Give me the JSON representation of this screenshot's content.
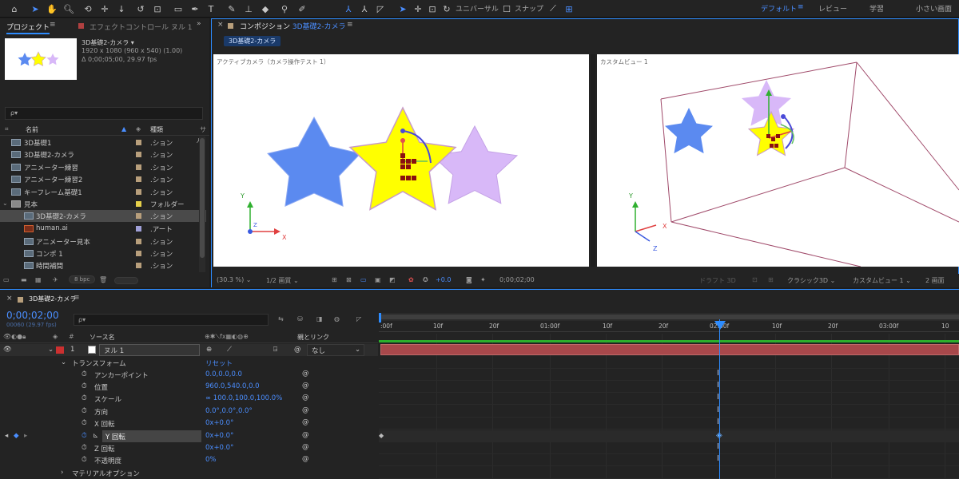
{
  "toolbar": {
    "home": "⌂",
    "snapping_label": "スナップ",
    "universal_label": "ユニバーサル"
  },
  "workspaces": {
    "default": "デフォルト",
    "review": "レビュー",
    "learn": "学習",
    "small": "小さい画面"
  },
  "project": {
    "tab_label": "プロジェクト",
    "effect_tab_label": "エフェクトコントロール ヌル 1",
    "comp_name": "3D基礎2-カメラ ▾",
    "comp_size": "1920 x 1080  (960 x 540) (1.00)",
    "comp_duration": "Δ 0;00;05;00, 29.97 fps",
    "search_placeholder": "ρ▾",
    "col_name": "名前",
    "col_type": "種類",
    "items": [
      {
        "name": "3D基礎1",
        "type": ".ション"
      },
      {
        "name": "3D基礎2-カメラ",
        "type": ".ション"
      },
      {
        "name": "アニメーター練習",
        "type": ".ション"
      },
      {
        "name": "アニメーター練習2",
        "type": ".ション"
      },
      {
        "name": "キーフレーム基礎1",
        "type": ".ション"
      },
      {
        "name": "見本",
        "type": "フォルダー"
      },
      {
        "name": "3D基礎2-カメラ",
        "type": ".ション"
      },
      {
        "name": "human.ai",
        "type": ".アート"
      },
      {
        "name": "アニメーター見本",
        "type": ".ション"
      },
      {
        "name": "コンポ 1",
        "type": ".ション"
      },
      {
        "name": "時間補間",
        "type": ".ション"
      }
    ],
    "bpc": "8 bpc"
  },
  "composition": {
    "tab_label": "コンポジション",
    "comp_title": "3D基礎2-カメラ",
    "subtab": "3D基礎2-カメラ",
    "left_view_label": "アクティブカメラ（カメラ操作テスト 1）",
    "right_view_label": "カスタムビュー 1",
    "zoom": "(30.3 %)",
    "resolution": "1/2 画質",
    "exposure": "+0.0",
    "timecode": "0;00;02;00",
    "draft3d": "ドラフト 3D",
    "renderer": "クラシック3D",
    "view": "カスタムビュー 1",
    "views_count": "2 画面"
  },
  "timeline": {
    "tab_label": "3D基礎2-カメラ",
    "timecode": "0;00;02;00",
    "frames": "00060 (29.97 fps)",
    "search_placeholder": "ρ▾",
    "col_source": "ソース名",
    "col_parent": "親とリンク",
    "layer_num": "1",
    "layer_name": "ヌル 1",
    "parent_value": "なし",
    "transform": "トランスフォーム",
    "reset": "リセット",
    "props": [
      {
        "name": "アンカーポイント",
        "value": "0.0,0.0,0.0"
      },
      {
        "name": "位置",
        "value": "960.0,540.0,0.0"
      },
      {
        "name": "スケール",
        "value": "∞ 100.0,100.0,100.0%"
      },
      {
        "name": "方向",
        "value": "0.0°,0.0°,0.0°"
      },
      {
        "name": "X 回転",
        "value": "0x+0.0°"
      },
      {
        "name": "Y 回転",
        "value": "0x+0.0°"
      },
      {
        "name": "Z 回転",
        "value": "0x+0.0°"
      },
      {
        "name": "不透明度",
        "value": "0%"
      }
    ],
    "material": "マテリアルオプション",
    "ruler": [
      ":00f",
      "10f",
      "20f",
      "01:00f",
      "10f",
      "20f",
      "02:00f",
      "10f",
      "20f",
      "03:00f",
      "10"
    ]
  },
  "colors": {
    "accent": "#2d8cff",
    "star_blue": "#5b8af0",
    "star_yellow": "#ffff00",
    "star_purple": "#d8b8f8",
    "layer_bar": "#a8484b"
  }
}
